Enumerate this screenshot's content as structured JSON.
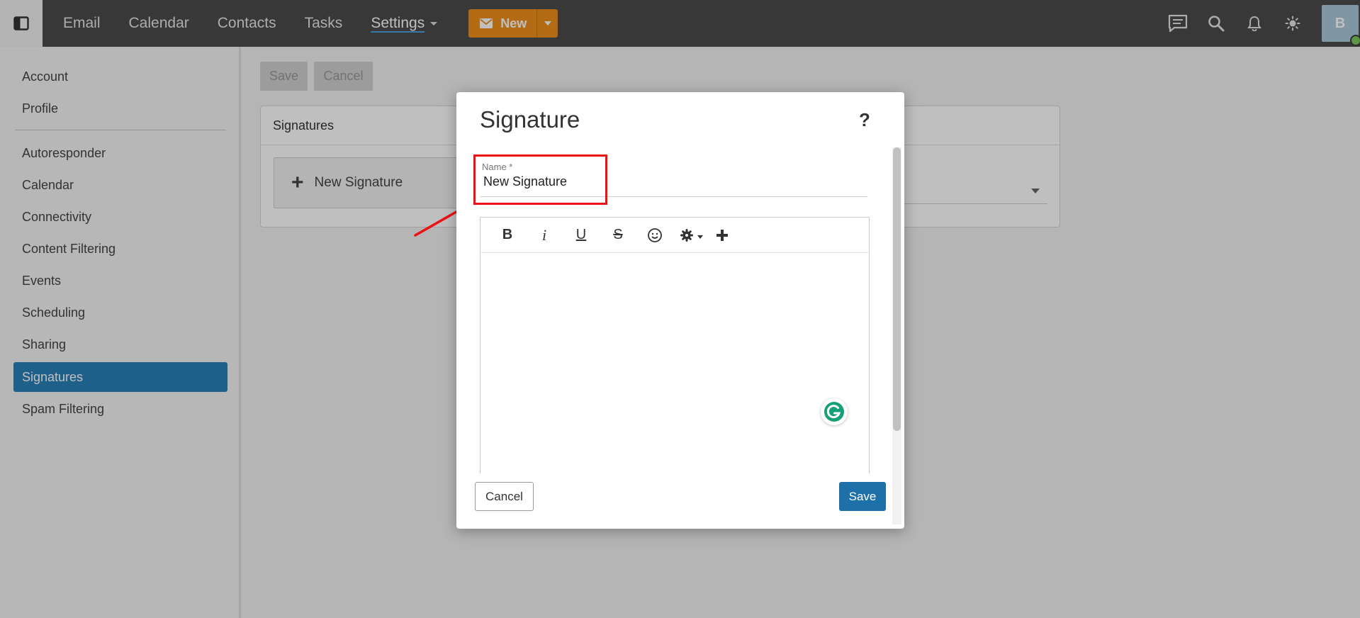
{
  "topbar": {
    "nav": [
      "Email",
      "Calendar",
      "Contacts",
      "Tasks",
      "Settings"
    ],
    "new_label": "New",
    "avatar_initial": "B"
  },
  "settings_nav": {
    "items": [
      "Account",
      "Profile",
      "Autoresponder",
      "Calendar",
      "Connectivity",
      "Content Filtering",
      "Events",
      "Scheduling",
      "Sharing",
      "Signatures",
      "Spam Filtering"
    ],
    "active": "Signatures"
  },
  "main": {
    "save_label": "Save",
    "cancel_label": "Cancel",
    "panel_title": "Signatures",
    "new_signature_label": "New Signature"
  },
  "modal": {
    "title": "Signature",
    "help": "?",
    "name_label": "Name *",
    "name_value": "New Signature",
    "cancel_label": "Cancel",
    "save_label": "Save"
  },
  "colors": {
    "topbar": "#4b4b4b",
    "new_button": "#ef8f1b",
    "active_nav": "#2a80b9",
    "save_button": "#1d70a8",
    "annotation": "#ee1111"
  },
  "icons": [
    "sidebar-toggle-icon",
    "mail-icon",
    "chat-icon",
    "search-icon",
    "bell-icon",
    "sun-icon",
    "help-icon",
    "bold-icon",
    "italic-icon",
    "underline-icon",
    "strikethrough-icon",
    "emoji-icon",
    "gear-icon",
    "plus-icon",
    "grammarly-icon"
  ]
}
